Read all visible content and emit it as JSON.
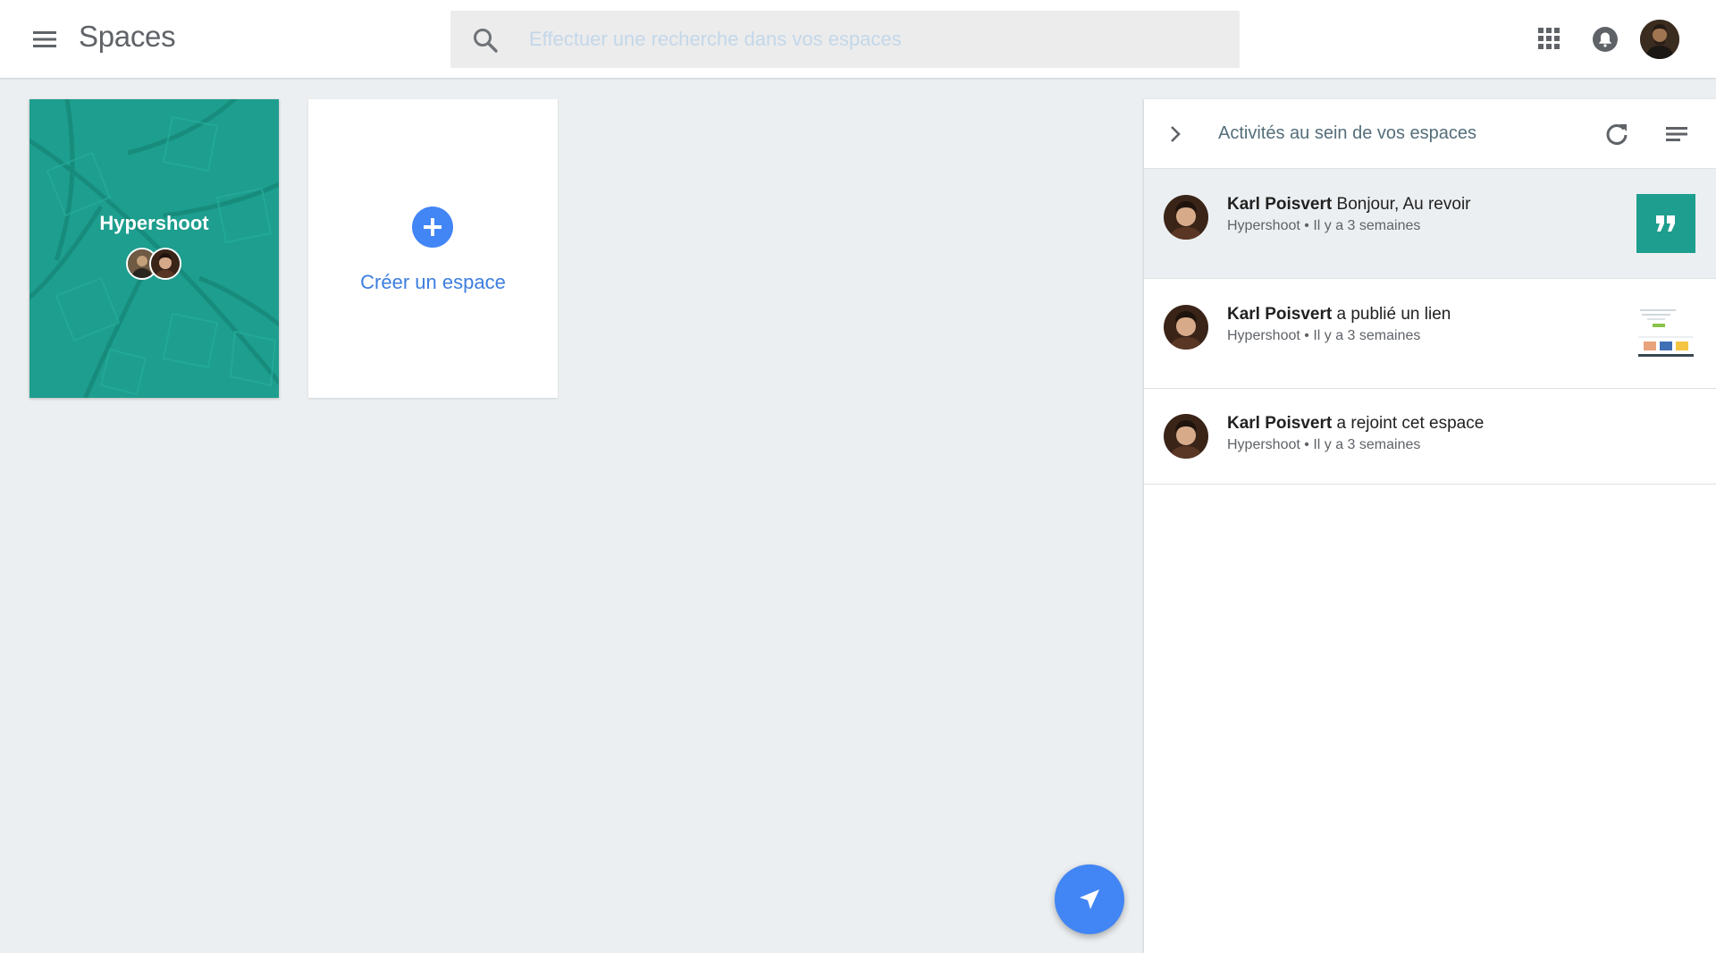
{
  "header": {
    "app_title": "Spaces",
    "search_placeholder": "Effectuer une recherche dans vos espaces",
    "icons": [
      "menu-icon",
      "search-icon",
      "apps-grid-icon",
      "notifications-bell-icon",
      "user-avatar"
    ]
  },
  "spaces": [
    {
      "name": "Hypershoot",
      "color": "#1e9e8e",
      "member_count": 2
    }
  ],
  "create_space": {
    "label": "Créer un espace",
    "accent": "#4285f4"
  },
  "activity": {
    "title": "Activités au sein de vos espaces",
    "items": [
      {
        "author": "Karl Poisvert",
        "action": "Bonjour, Au revoir",
        "space": "Hypershoot",
        "time": "Il y a 3 semaines",
        "meta": "Hypershoot • Il y a 3 semaines",
        "thumbnail": "quote-icon",
        "selected": true
      },
      {
        "author": "Karl Poisvert",
        "action": "a publié un lien",
        "space": "Hypershoot",
        "time": "Il y a 3 semaines",
        "meta": "Hypershoot • Il y a 3 semaines",
        "thumbnail": "link-preview"
      },
      {
        "author": "Karl Poisvert",
        "action": "a rejoint cet espace",
        "space": "Hypershoot",
        "time": "Il y a 3 semaines",
        "meta": "Hypershoot • Il y a 3 semaines",
        "thumbnail": ""
      }
    ]
  },
  "fab": {
    "icon": "send-icon",
    "color": "#4285f4"
  }
}
